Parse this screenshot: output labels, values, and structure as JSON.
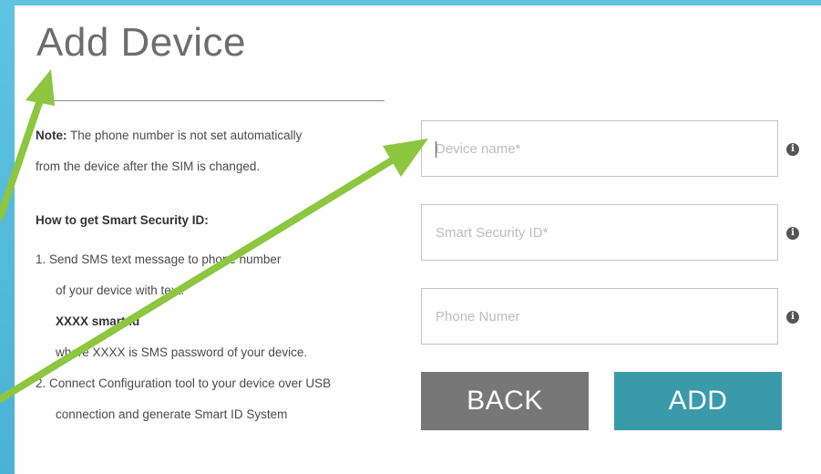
{
  "page": {
    "title": "Add Device"
  },
  "note": {
    "label": "Note:",
    "text_line1": " The phone number is not set automatically",
    "text_line2": "from the device after the SIM is changed."
  },
  "howto": {
    "title": "How to get Smart Security ID:",
    "lines": [
      "1. Send SMS text message to phone number",
      "of your device with text:",
      "XXXX smart id",
      "where XXXX is SMS password of your device.",
      "2. Connect Configuration tool to your device over USB",
      "connection and generate Smart ID System"
    ]
  },
  "form": {
    "device_name": {
      "value": "",
      "placeholder": "Device name*"
    },
    "smart_security_id": {
      "value": "",
      "placeholder": "Smart Security ID*"
    },
    "phone_number": {
      "value": "",
      "placeholder": "Phone Numer"
    },
    "info_glyph": "i"
  },
  "buttons": {
    "back_label": "BACK",
    "add_label": "ADD"
  },
  "colors": {
    "background": "#5fc3e0",
    "arrow": "#8dc63f",
    "back_button": "#777777",
    "add_button": "#3a9aaa"
  },
  "icons": {
    "info": "info-circle-icon",
    "arrow": "annotation-arrow-icon"
  }
}
